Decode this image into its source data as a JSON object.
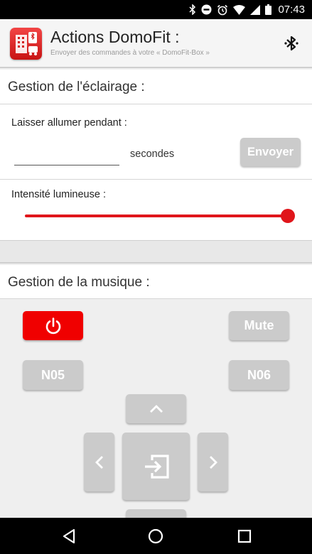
{
  "status_bar": {
    "time": "07:43",
    "icons": [
      "bluetooth-icon",
      "do-not-disturb-icon",
      "alarm-icon",
      "wifi-icon",
      "signal-icon",
      "battery-icon"
    ]
  },
  "app_bar": {
    "title": "Actions DomoFit :",
    "subtitle": "Envoyer des commandes à votre « DomoFit-Box »",
    "action_icon": "bluetooth-icon"
  },
  "lighting": {
    "section_title": "Gestion de l'éclairage :",
    "duration_label": "Laisser allumer pendant :",
    "duration_value": "",
    "duration_unit": "secondes",
    "send_label": "Envoyer",
    "intensity_label": "Intensité lumineuse :",
    "intensity_level": 1.0
  },
  "music": {
    "section_title": "Gestion de la musique :",
    "power_icon": "power-icon",
    "mute_label": "Mute",
    "preset_left": "N05",
    "preset_right": "N06",
    "up_icon": "chevron-up-icon",
    "left_icon": "chevron-left-icon",
    "center_icon": "input-enter-icon",
    "right_icon": "chevron-right-icon"
  },
  "nav_bar": {
    "icons": [
      "back-icon",
      "home-icon",
      "recents-icon"
    ]
  },
  "colors": {
    "accent_red": "#e0161b",
    "power_red": "#f00000",
    "button_gray": "#cbcbcb"
  }
}
